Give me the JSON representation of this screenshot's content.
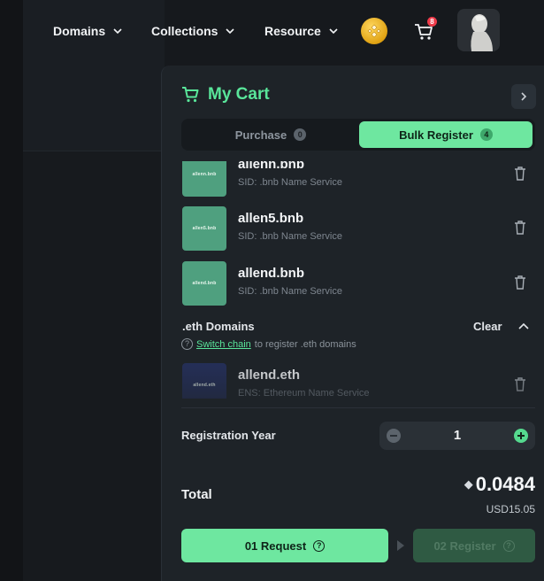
{
  "nav": {
    "items": [
      {
        "label": "Domains"
      },
      {
        "label": "Collections"
      },
      {
        "label": "Resource"
      }
    ],
    "cart_badge": "8"
  },
  "cart": {
    "title": "My Cart",
    "tabs": [
      {
        "label": "Purchase",
        "count": "0"
      },
      {
        "label": "Bulk Register",
        "count": "4"
      }
    ],
    "bnb_items": [
      {
        "name": "allenn.bnb",
        "service": "SID: .bnb Name Service",
        "thumb_text": "allenn.bnb"
      },
      {
        "name": "allen5.bnb",
        "service": "SID: .bnb Name Service",
        "thumb_text": "allen5.bnb"
      },
      {
        "name": "allend.bnb",
        "service": "SID: .bnb Name Service",
        "thumb_text": "allend.bnb"
      }
    ],
    "eth_section": {
      "title": ".eth Domains",
      "clear_label": "Clear",
      "note_link": "Switch chain",
      "note_text": "to register .eth domains",
      "items": [
        {
          "name": "allend.eth",
          "service": "ENS: Ethereum Name Service",
          "thumb_text": "allend.eth"
        }
      ]
    },
    "registration_year": {
      "label": "Registration Year",
      "value": "1"
    },
    "total": {
      "label": "Total",
      "eth_value": "0.0484",
      "usd_value": "USD15.05"
    },
    "buttons": {
      "request": "01 Request",
      "register": "02 Register"
    },
    "colors": {
      "accent": "#6ee7a0",
      "title_green": "#59e59a",
      "badge_red": "#ef3b4a"
    }
  }
}
